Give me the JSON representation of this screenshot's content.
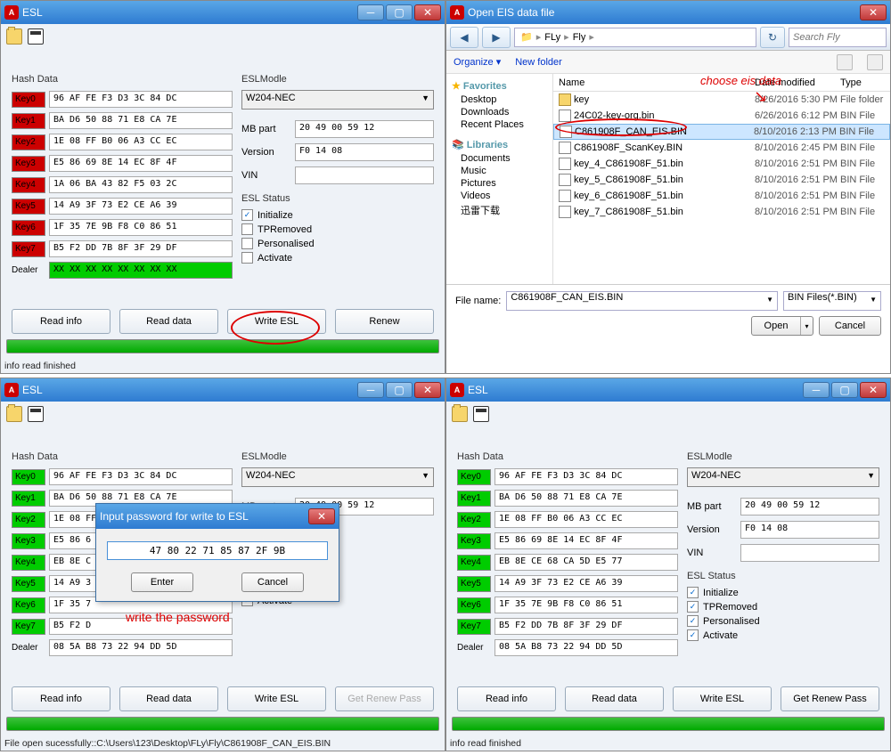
{
  "panel1": {
    "title": "ESL",
    "hash_label": "Hash Data",
    "keys": [
      {
        "n": "Key0",
        "v": "96 AF FE F3 D3 3C 84 DC",
        "color": "red"
      },
      {
        "n": "Key1",
        "v": "BA D6 50 88 71 E8 CA 7E",
        "color": "red"
      },
      {
        "n": "Key2",
        "v": "1E 08 FF B0 06 A3 CC EC",
        "color": "red"
      },
      {
        "n": "Key3",
        "v": "E5 86 69 8E 14 EC 8F 4F",
        "color": "red"
      },
      {
        "n": "Key4",
        "v": "1A 06 BA 43 82 F5 03 2C",
        "color": "red"
      },
      {
        "n": "Key5",
        "v": "14 A9 3F 73 E2 CE A6 39",
        "color": "red"
      },
      {
        "n": "Key6",
        "v": "1F 35 7E 9B F8 C0 86 51",
        "color": "red"
      },
      {
        "n": "Key7",
        "v": "B5 F2 DD 7B 8F 3F 29 DF",
        "color": "red"
      }
    ],
    "dealer_label": "Dealer",
    "dealer": "XX XX XX XX XX XX XX XX",
    "model_label": "ESLModle",
    "model": "W204-NEC",
    "mbpart_label": "MB part",
    "mbpart": "20 49 00 59 12",
    "version_label": "Version",
    "version": "F0 14 08",
    "vin_label": "VIN",
    "vin": "",
    "status_label": "ESL Status",
    "statuses": [
      {
        "l": "Initialize",
        "c": true
      },
      {
        "l": "TPRemoved",
        "c": false
      },
      {
        "l": "Personalised",
        "c": false
      },
      {
        "l": "Activate",
        "c": false
      }
    ],
    "buttons": [
      "Read info",
      "Read data",
      "Write ESL",
      "Renew"
    ],
    "statusline": "info read finished"
  },
  "panel2": {
    "title": "Open EIS data file",
    "nav_path": [
      "FLy",
      "Fly"
    ],
    "search_placeholder": "Search Fly",
    "organize": "Organize ▾",
    "newfolder": "New folder",
    "fav_label": "Favorites",
    "favs": [
      "Desktop",
      "Downloads",
      "Recent Places"
    ],
    "lib_label": "Libraries",
    "libs": [
      "Documents",
      "Music",
      "Pictures",
      "Videos",
      "迅雷下载"
    ],
    "cols": [
      "Name",
      "Date modified",
      "Type"
    ],
    "rows": [
      {
        "n": "key",
        "d": "8/26/2016 5:30 PM",
        "t": "File folder",
        "folder": true
      },
      {
        "n": "24C02-key-org.bin",
        "d": "6/26/2016 6:12 PM",
        "t": "BIN File"
      },
      {
        "n": "C861908F_CAN_EIS.BIN",
        "d": "8/10/2016 2:13 PM",
        "t": "BIN File",
        "sel": true
      },
      {
        "n": "C861908F_ScanKey.BIN",
        "d": "8/10/2016 2:45 PM",
        "t": "BIN File"
      },
      {
        "n": "key_4_C861908F_51.bin",
        "d": "8/10/2016 2:51 PM",
        "t": "BIN File"
      },
      {
        "n": "key_5_C861908F_51.bin",
        "d": "8/10/2016 2:51 PM",
        "t": "BIN File"
      },
      {
        "n": "key_6_C861908F_51.bin",
        "d": "8/10/2016 2:51 PM",
        "t": "BIN File"
      },
      {
        "n": "key_7_C861908F_51.bin",
        "d": "8/10/2016 2:51 PM",
        "t": "BIN File"
      }
    ],
    "filename_label": "File name:",
    "filename": "C861908F_CAN_EIS.BIN",
    "filetype": "BIN Files(*.BIN)",
    "open": "Open",
    "cancel": "Cancel",
    "annotation": "choose eis data"
  },
  "panel3": {
    "title": "ESL",
    "hash_label": "Hash Data",
    "keys": [
      {
        "n": "Key0",
        "v": "96 AF FE F3 D3 3C 84 DC",
        "color": "green"
      },
      {
        "n": "Key1",
        "v": "BA D6 50 88 71 E8 CA 7E",
        "color": "green"
      },
      {
        "n": "Key2",
        "v": "1E 08 FF B0 06 A3 CC EC",
        "color": "green"
      },
      {
        "n": "Key3",
        "v": "E5 86 6",
        "color": "green"
      },
      {
        "n": "Key4",
        "v": "EB 8E C",
        "color": "green"
      },
      {
        "n": "Key5",
        "v": "14 A9 3",
        "color": "green"
      },
      {
        "n": "Key6",
        "v": "1F 35 7",
        "color": "green"
      },
      {
        "n": "Key7",
        "v": "B5 F2 D",
        "color": "green"
      }
    ],
    "dealer_label": "Dealer",
    "dealer": "08 5A B8 73 22 94 DD 5D",
    "model_label": "ESLModle",
    "model": "W204-NEC",
    "mbpart_label": "MB part",
    "mbpart": "20 49 00 59 12",
    "activate_label": "Activate",
    "buttons": [
      "Read info",
      "Read data",
      "Write ESL",
      "Get Renew Pass"
    ],
    "statusline": "File open sucessfully::C:\\Users\\123\\Desktop\\FLy\\Fly\\C861908F_CAN_EIS.BIN",
    "dlg_title": "Input password for write to ESL",
    "dlg_value": "47 80 22 71 85 87 2F 9B",
    "dlg_enter": "Enter",
    "dlg_cancel": "Cancel",
    "annotation": "write the password"
  },
  "panel4": {
    "title": "ESL",
    "hash_label": "Hash Data",
    "keys": [
      {
        "n": "Key0",
        "v": "96 AF FE F3 D3 3C 84 DC",
        "color": "green"
      },
      {
        "n": "Key1",
        "v": "BA D6 50 88 71 E8 CA 7E",
        "color": "green"
      },
      {
        "n": "Key2",
        "v": "1E 08 FF B0 06 A3 CC EC",
        "color": "green"
      },
      {
        "n": "Key3",
        "v": "E5 86 69 8E 14 EC 8F 4F",
        "color": "green"
      },
      {
        "n": "Key4",
        "v": "EB 8E CE 68 CA 5D E5 77",
        "color": "green"
      },
      {
        "n": "Key5",
        "v": "14 A9 3F 73 E2 CE A6 39",
        "color": "green"
      },
      {
        "n": "Key6",
        "v": "1F 35 7E 9B F8 C0 86 51",
        "color": "green"
      },
      {
        "n": "Key7",
        "v": "B5 F2 DD 7B 8F 3F 29 DF",
        "color": "green"
      }
    ],
    "dealer_label": "Dealer",
    "dealer": "08 5A B8 73 22 94 DD 5D",
    "model_label": "ESLModle",
    "model": "W204-NEC",
    "mbpart_label": "MB part",
    "mbpart": "20 49 00 59 12",
    "version_label": "Version",
    "version": "F0 14 08",
    "vin_label": "VIN",
    "vin": "",
    "status_label": "ESL Status",
    "statuses": [
      {
        "l": "Initialize",
        "c": true
      },
      {
        "l": "TPRemoved",
        "c": true
      },
      {
        "l": "Personalised",
        "c": true
      },
      {
        "l": "Activate",
        "c": true
      }
    ],
    "buttons": [
      "Read info",
      "Read data",
      "Write ESL",
      "Get Renew Pass"
    ],
    "statusline": "info read finished"
  }
}
